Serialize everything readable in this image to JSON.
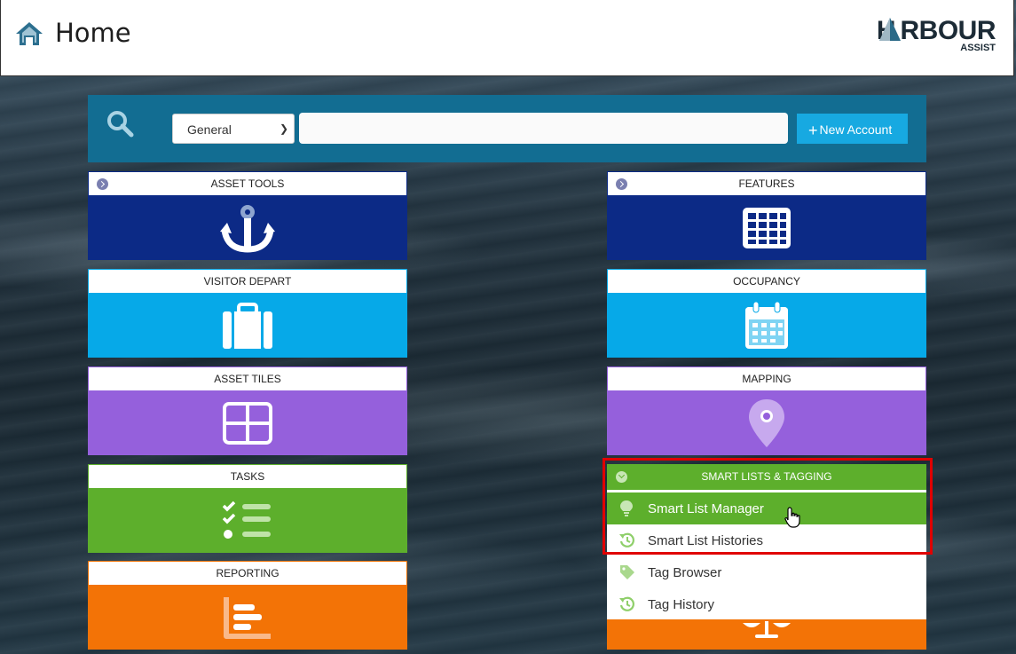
{
  "header": {
    "title": "Home",
    "logo_main": "H RBOUR",
    "logo_sub": "ASSIST"
  },
  "search": {
    "category_selected": "General",
    "query_value": "",
    "new_account_label": "New Account"
  },
  "tiles": {
    "asset_tools": "ASSET TOOLS",
    "visitor_depart": "VISITOR DEPART",
    "asset_tiles": "ASSET TILES",
    "tasks": "TASKS",
    "reporting": "REPORTING",
    "features": "FEATURES",
    "occupancy": "OCCUPANCY",
    "mapping": "MAPPING"
  },
  "smart_lists": {
    "title": "SMART LISTS & TAGGING",
    "items": [
      {
        "label": "Smart List Manager",
        "icon": "lightbulb-icon"
      },
      {
        "label": "Smart List Histories",
        "icon": "history-icon"
      },
      {
        "label": "Tag Browser",
        "icon": "tag-icon"
      },
      {
        "label": "Tag History",
        "icon": "history-icon"
      }
    ]
  },
  "colors": {
    "navy": "#0c2a86",
    "sky": "#06a9e8",
    "purple": "#9560dc",
    "green": "#5daf2c",
    "orange": "#f37306",
    "searchbar": "#126d92",
    "highlight": "#e00000"
  }
}
